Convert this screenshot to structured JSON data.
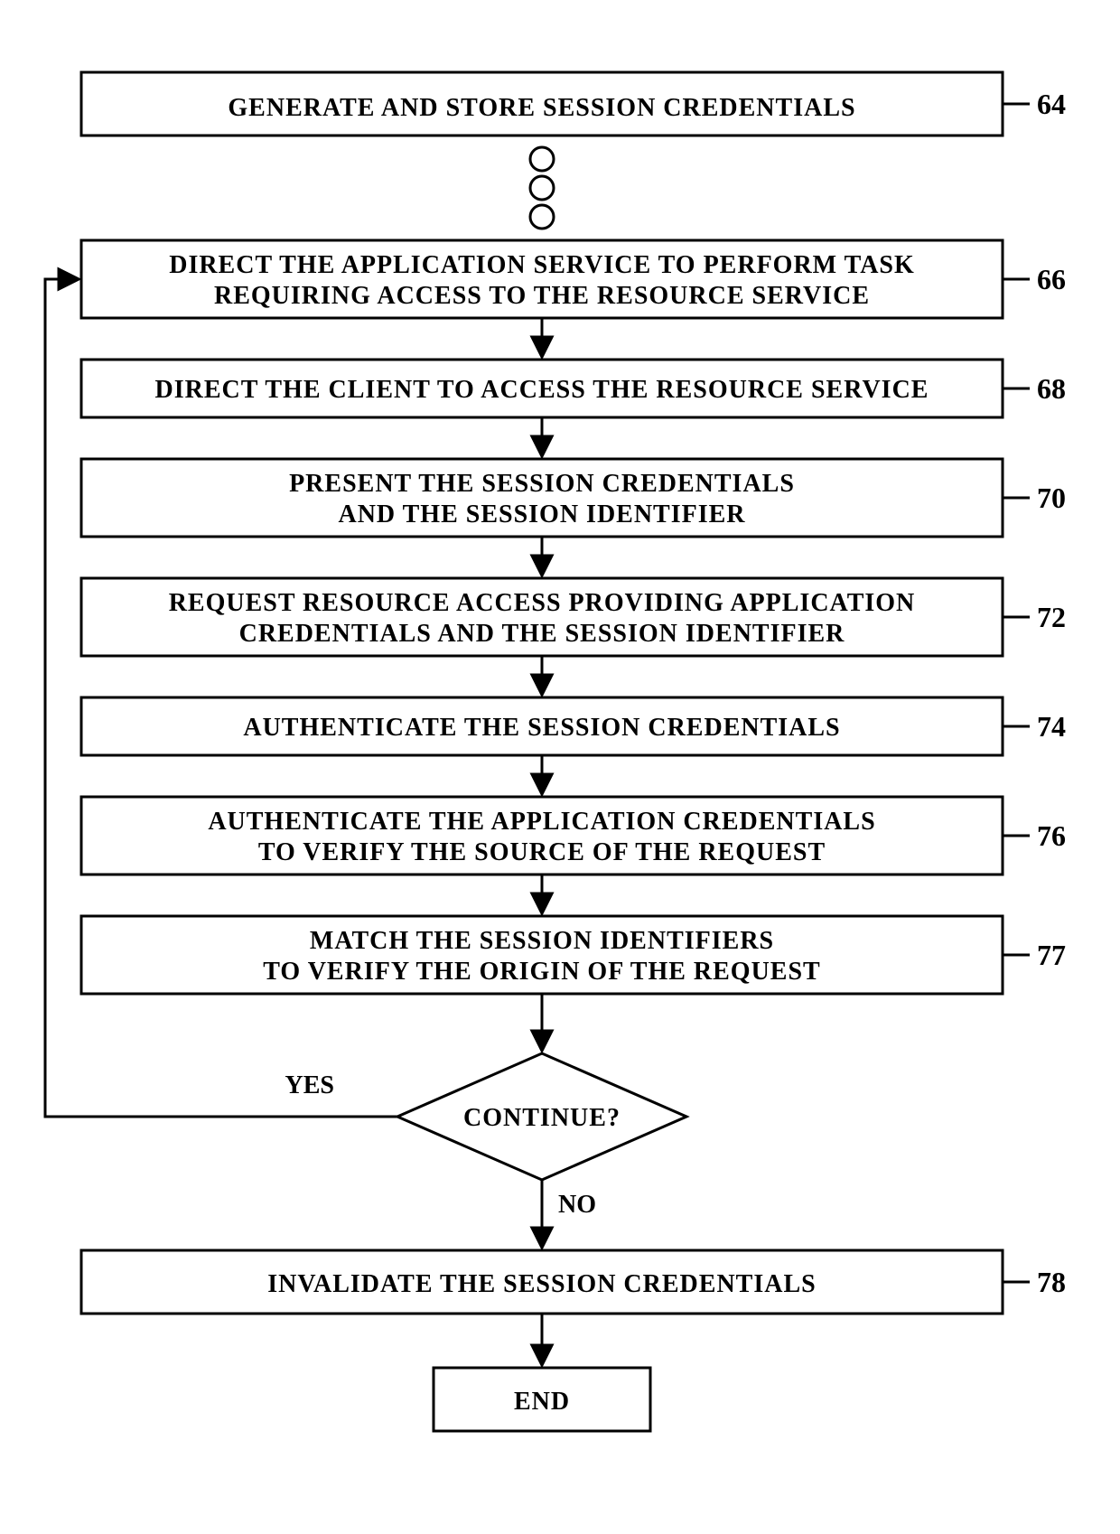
{
  "boxes": {
    "b64": {
      "lines": [
        "GENERATE AND STORE SESSION CREDENTIALS"
      ],
      "ref": "64"
    },
    "b66": {
      "lines": [
        "DIRECT THE APPLICATION SERVICE TO PERFORM TASK",
        "REQUIRING ACCESS TO THE RESOURCE SERVICE"
      ],
      "ref": "66"
    },
    "b68": {
      "lines": [
        "DIRECT THE CLIENT TO ACCESS THE RESOURCE SERVICE"
      ],
      "ref": "68"
    },
    "b70": {
      "lines": [
        "PRESENT THE SESSION CREDENTIALS",
        "AND THE SESSION IDENTIFIER"
      ],
      "ref": "70"
    },
    "b72": {
      "lines": [
        "REQUEST RESOURCE ACCESS PROVIDING APPLICATION",
        "CREDENTIALS AND THE SESSION IDENTIFIER"
      ],
      "ref": "72"
    },
    "b74": {
      "lines": [
        "AUTHENTICATE THE SESSION CREDENTIALS"
      ],
      "ref": "74"
    },
    "b76": {
      "lines": [
        "AUTHENTICATE THE APPLICATION CREDENTIALS",
        "TO VERIFY THE SOURCE OF THE REQUEST"
      ],
      "ref": "76"
    },
    "b77": {
      "lines": [
        "MATCH THE SESSION IDENTIFIERS",
        "TO VERIFY THE ORIGIN OF THE REQUEST"
      ],
      "ref": "77"
    },
    "b78": {
      "lines": [
        "INVALIDATE THE SESSION CREDENTIALS"
      ],
      "ref": "78"
    },
    "end": {
      "lines": [
        "END"
      ]
    }
  },
  "decision": {
    "label": "CONTINUE?",
    "yes": "YES",
    "no": "NO"
  }
}
